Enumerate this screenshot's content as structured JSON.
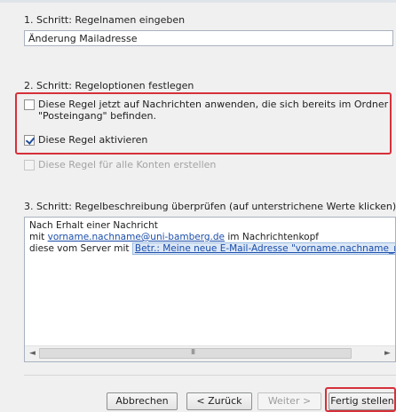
{
  "step1": {
    "title": "1. Schritt: Regelnamen eingeben",
    "rule_name": "Änderung Mailadresse"
  },
  "step2": {
    "title": "2. Schritt: Regeloptionen festlegen",
    "options": [
      {
        "label_line1": "Diese Regel jetzt auf Nachrichten anwenden, die sich bereits im Ordner",
        "label_line2": "\"Posteingang\" befinden.",
        "checked": false,
        "enabled": true
      },
      {
        "label": "Diese Regel aktivieren",
        "checked": true,
        "enabled": true
      },
      {
        "label": "Diese Regel für alle Konten erstellen",
        "checked": false,
        "enabled": false
      }
    ]
  },
  "step3": {
    "title": "3. Schritt: Regelbeschreibung überprüfen (auf unterstrichene Werte klicken)",
    "description": {
      "line1": "Nach Erhalt einer Nachricht",
      "line2_prefix": "mit ",
      "line2_link": "vorname.nachname@uni-bamberg.de",
      "line2_suffix": " im Nachrichtenkopf",
      "line3_prefix": "diese vom Server mit ",
      "line3_link": "Betr.: Meine neue E-Mail-Adresse \"vorname.nachname_ne"
    }
  },
  "buttons": {
    "cancel": "Abbrechen",
    "back": "< Zurück",
    "next": "Weiter >",
    "finish": "Fertig stellen"
  },
  "colors": {
    "highlight_border": "#d6303a",
    "link": "#1a4dab",
    "checkbox_check": "#1f4d9a"
  },
  "icons": {
    "scroll_left": "◄",
    "scroll_right": "►",
    "scroll_grip": "III"
  }
}
